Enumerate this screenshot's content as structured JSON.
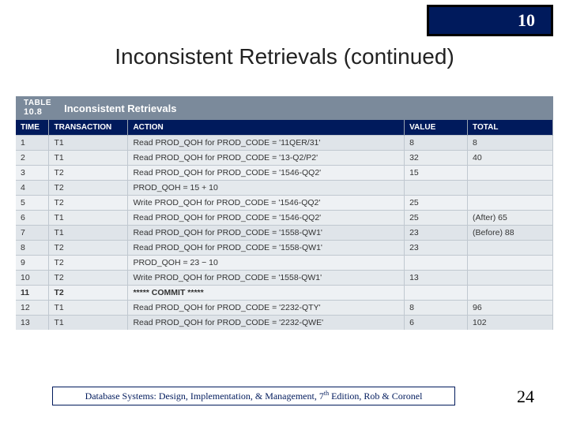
{
  "chapter": "10",
  "title": "Inconsistent Retrievals (continued)",
  "table": {
    "tag": "TABLE",
    "number": "10.8",
    "caption": "Inconsistent Retrievals",
    "headers": {
      "time": "TIME",
      "transaction": "TRANSACTION",
      "action": "ACTION",
      "value": "VALUE",
      "total": "TOTAL"
    },
    "rows": [
      {
        "time": "1",
        "tx": "T1",
        "action": "Read PROD_QOH for PROD_CODE = '11QER/31'",
        "value": "8",
        "total": "8"
      },
      {
        "time": "2",
        "tx": "T1",
        "action": "Read PROD_QOH for PROD_CODE = '13-Q2/P2'",
        "value": "32",
        "total": "40"
      },
      {
        "time": "3",
        "tx": "T2",
        "action": "Read PROD_QOH for PROD_CODE = '1546-QQ2'",
        "value": "15",
        "total": ""
      },
      {
        "time": "4",
        "tx": "T2",
        "action": "PROD_QOH = 15 + 10",
        "value": "",
        "total": ""
      },
      {
        "time": "5",
        "tx": "T2",
        "action": "Write PROD_QOH for PROD_CODE = '1546-QQ2'",
        "value": "25",
        "total": ""
      },
      {
        "time": "6",
        "tx": "T1",
        "action": "Read PROD_QOH for PROD_CODE = '1546-QQ2'",
        "value": "25",
        "total": "(After) 65"
      },
      {
        "time": "7",
        "tx": "T1",
        "action": "Read PROD_QOH for PROD_CODE = '1558-QW1'",
        "value": "23",
        "total": "(Before) 88"
      },
      {
        "time": "8",
        "tx": "T2",
        "action": "Read PROD_QOH for PROD_CODE = '1558-QW1'",
        "value": "23",
        "total": ""
      },
      {
        "time": "9",
        "tx": "T2",
        "action": "PROD_QOH = 23 − 10",
        "value": "",
        "total": ""
      },
      {
        "time": "10",
        "tx": "T2",
        "action": "Write PROD_QOH for PROD_CODE = '1558-QW1'",
        "value": "13",
        "total": ""
      },
      {
        "time": "11",
        "tx": "T2",
        "action": "***** COMMIT *****",
        "value": "",
        "total": ""
      },
      {
        "time": "12",
        "tx": "T1",
        "action": "Read PROD_QOH for PROD_CODE = '2232-QTY'",
        "value": "8",
        "total": "96"
      },
      {
        "time": "13",
        "tx": "T1",
        "action": "Read PROD_QOH for PROD_CODE = '2232-QWE'",
        "value": "6",
        "total": "102"
      }
    ]
  },
  "footer": {
    "prefix": "Database Systems: Design, Implementation, & Management, 7",
    "sup": "th",
    "suffix": " Edition, Rob & Coronel"
  },
  "page_number": "24"
}
